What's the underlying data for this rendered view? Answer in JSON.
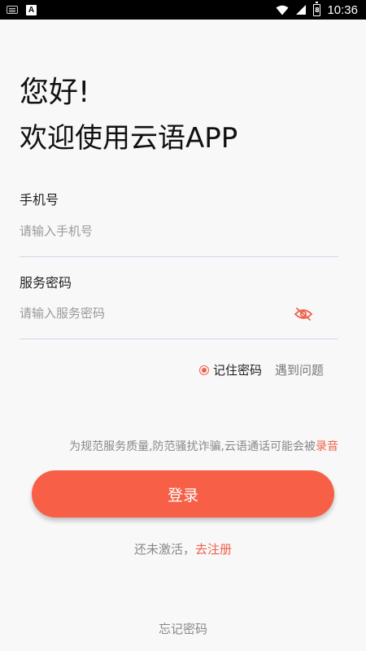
{
  "statusbar": {
    "time": "10:36",
    "app_badge": "A",
    "battery_level": "8",
    "icons": [
      "keyboard-icon",
      "a-icon",
      "wifi-icon",
      "signal-icon",
      "battery-icon"
    ]
  },
  "greeting": "您好!",
  "welcome": "欢迎使用云语APP",
  "phone": {
    "label": "手机号",
    "placeholder": "请输入手机号",
    "value": ""
  },
  "password": {
    "label": "服务密码",
    "placeholder": "请输入服务密码",
    "value": "",
    "toggle_icon": "eye-hidden-icon"
  },
  "options": {
    "remember_label": "记住密码",
    "remember_checked": true,
    "problem_label": "遇到问题"
  },
  "notice": {
    "text": "为规范服务质量,防范骚扰诈骗,云语通话可能会被",
    "highlight": "录音"
  },
  "login_button": "登录",
  "register": {
    "prefix": "还未激活，",
    "link": "去注册"
  },
  "forgot": "忘记密码",
  "colors": {
    "accent": "#f76047",
    "background": "#f8f8f8",
    "underline": "#cfd6e6"
  }
}
